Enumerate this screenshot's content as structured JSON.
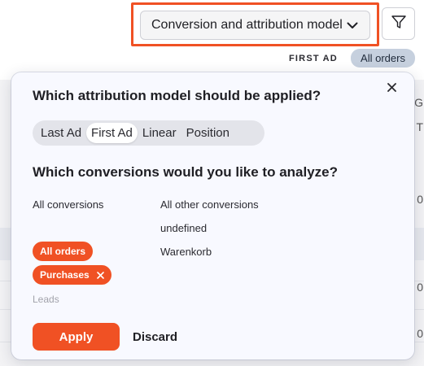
{
  "toolbar": {
    "model_dropdown_label": "Conversion and attribution model",
    "active_model_tag": "FIRST AD",
    "active_conversion_tag": "All orders"
  },
  "background": {
    "peek_chars": [
      "G",
      "T",
      "0",
      "0",
      "0"
    ]
  },
  "popover": {
    "attribution_heading": "Which attribution model should be applied?",
    "models": [
      {
        "label": "Last Ad",
        "active": false
      },
      {
        "label": "First Ad",
        "active": true
      },
      {
        "label": "Linear",
        "active": false
      },
      {
        "label": "Position",
        "active": false
      }
    ],
    "conversions_heading": "Which conversions would you like to analyze?",
    "left_column": {
      "all_conversions": "All conversions",
      "selected_chips": [
        "All orders",
        "Purchases"
      ],
      "disabled_option": "Leads"
    },
    "right_column": {
      "options": [
        "All other conversions",
        "undefined",
        "Warenkorb"
      ]
    },
    "apply_label": "Apply",
    "discard_label": "Discard"
  },
  "colors": {
    "accent": "#f05124",
    "tag_bg": "#c6d0de",
    "popover_bg": "#f8f9ff"
  },
  "icons": {
    "dropdown": "chevron-down-icon",
    "filter": "filter-funnel-icon",
    "close": "close-icon",
    "chip_remove": "close-icon"
  }
}
